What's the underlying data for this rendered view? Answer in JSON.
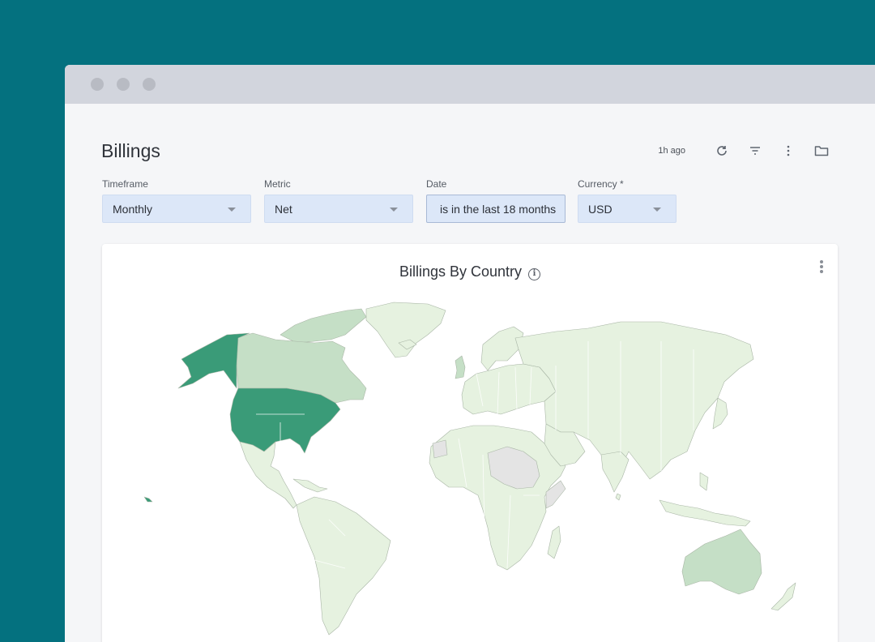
{
  "page": {
    "title": "Billings"
  },
  "toolbar": {
    "updated": "1h ago",
    "icons": [
      "refresh-icon",
      "filter-icon",
      "more-vert-icon",
      "folder-icon"
    ]
  },
  "filters": [
    {
      "label": "Timeframe",
      "value": "Monthly"
    },
    {
      "label": "Metric",
      "value": "Net"
    },
    {
      "label": "Date",
      "value": "is in the last 18 months"
    },
    {
      "label": "Currency *",
      "value": "USD"
    }
  ],
  "card": {
    "title": "Billings By Country",
    "info_icon": "i"
  },
  "colors": {
    "background": "#04717f",
    "window": "#f5f6f8",
    "titlebar": "#d2d5dd",
    "select_fill": "#dce7f8",
    "map_high": "#3a9b78",
    "map_mid": "#c5dfc6",
    "map_low": "#e6f2e0",
    "map_nodata": "#e4e4e4"
  },
  "map_data": {
    "highlighted": [
      "United States",
      "Alaska",
      "Hawaii"
    ],
    "medium": [
      "Canada",
      "United Kingdom",
      "Greenland",
      "Australia"
    ],
    "no_data": [
      "Western Sahara",
      "Libya",
      "Sudan",
      "Chad",
      "Somalia"
    ]
  }
}
